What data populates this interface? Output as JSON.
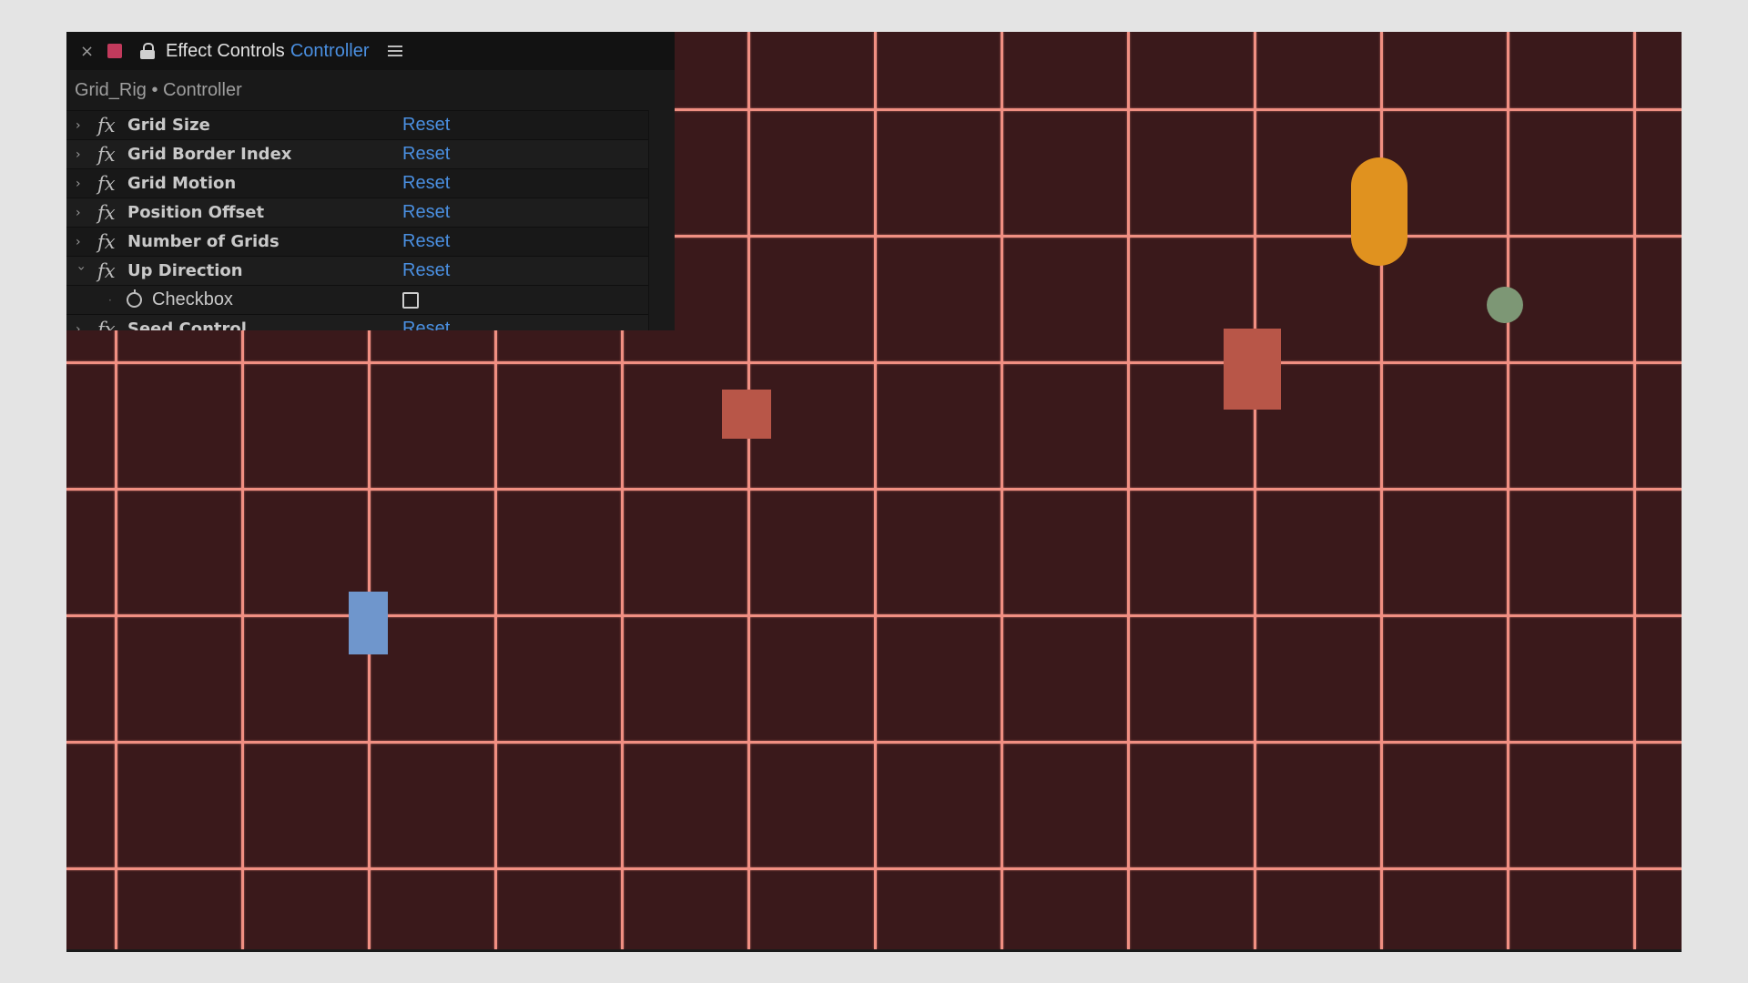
{
  "panel": {
    "close_glyph": "×",
    "label_color": "#c23a5c",
    "title": "Effect Controls",
    "layer_name": "Controller",
    "breadcrumb": "Grid_Rig • Controller",
    "reset_label": "Reset",
    "effects": [
      {
        "name": "Grid Size",
        "expanded": false
      },
      {
        "name": "Grid Border Index",
        "expanded": false
      },
      {
        "name": "Grid Motion",
        "expanded": false
      },
      {
        "name": "Position Offset",
        "expanded": false
      },
      {
        "name": "Number of Grids",
        "expanded": false
      },
      {
        "name": "Up Direction",
        "expanded": true
      },
      {
        "name": "Seed Control",
        "expanded": false
      }
    ],
    "sub_property": {
      "name": "Checkbox",
      "checked": false
    },
    "icons": [
      "close-icon",
      "lock-icon",
      "menu-icon",
      "fx-icon",
      "stopwatch-icon",
      "chevron-right-icon",
      "chevron-down-icon"
    ]
  },
  "composition": {
    "background_color": "#3a191b",
    "grid_color": "#f08f82",
    "shapes": [
      {
        "kind": "rectangle",
        "color": "#b85648"
      },
      {
        "kind": "rectangle",
        "color": "#b85648"
      },
      {
        "kind": "rectangle",
        "color": "#6f96cc"
      },
      {
        "kind": "capsule",
        "color": "#e0921f"
      },
      {
        "kind": "circle",
        "color": "#7d9775"
      }
    ]
  }
}
